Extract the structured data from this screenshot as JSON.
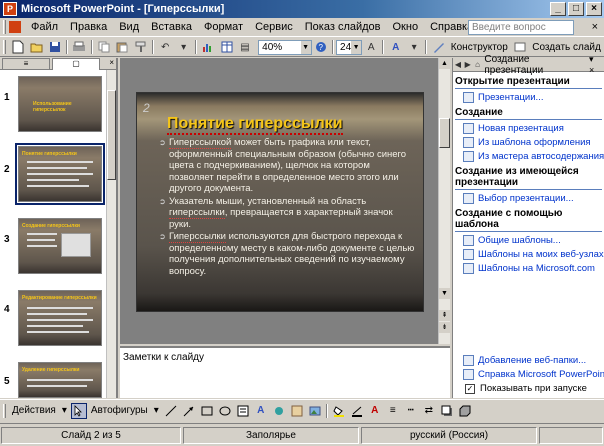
{
  "window": {
    "title": "Microsoft PowerPoint - [Гиперссылки]",
    "controls": {
      "minimize": "_",
      "maximize": "□",
      "close": "×"
    }
  },
  "menu": {
    "items": [
      "Файл",
      "Правка",
      "Вид",
      "Вставка",
      "Формат",
      "Сервис",
      "Показ слайдов",
      "Окно",
      "Справка"
    ],
    "question_placeholder": "Введите вопрос",
    "close": "×"
  },
  "toolbar": {
    "zoom": "40%",
    "font_size": "24",
    "font_color_label": "A",
    "design_label": "Конструктор",
    "new_slide_label": "Создать слайд"
  },
  "slides_pane": {
    "thumbnails": [
      {
        "number": "1",
        "title": "Использование гиперссылок"
      },
      {
        "number": "2",
        "title": "Понятие гиперссылки"
      },
      {
        "number": "3",
        "title": "Создание гиперссылки"
      },
      {
        "number": "4",
        "title": "Редактирование гиперссылки"
      },
      {
        "number": "5",
        "title": "Удаление гиперссылки"
      }
    ],
    "selected_index": 1
  },
  "slide": {
    "number": "2",
    "title": "Понятие гиперссылки",
    "bullets": [
      {
        "highlight": "Гиперссылкой",
        "text": " может быть графика или текст, оформленный специальным образом (обычно синего цвета с подчеркиванием), щелчок на котором позволяет перейти в определенное место этого или другого документа."
      },
      {
        "pre": "Указатель мыши, установленный на область ",
        "highlight": "гиперссылки",
        "post": ", превращается в характерный значок руки."
      },
      {
        "highlight": "Гиперссылки",
        "text": " используются для быстрого перехода к определенному месту в каком-либо документе с целью получения дополнительных сведений по изучаемому вопросу."
      }
    ]
  },
  "notes": {
    "placeholder": "Заметки к слайду"
  },
  "task_pane": {
    "title": "Создание презентации",
    "sections": [
      {
        "heading": "Открытие презентации",
        "links": [
          "Презентации..."
        ]
      },
      {
        "heading": "Создание",
        "links": [
          "Новая презентация",
          "Из шаблона оформления",
          "Из мастера автосодержания"
        ]
      },
      {
        "heading": "Создание из имеющейся презентации",
        "links": [
          "Выбор презентации..."
        ]
      },
      {
        "heading": "Создание с помощью шаблона",
        "links": [
          "Общие шаблоны...",
          "Шаблоны на моих веб-узлах...",
          "Шаблоны на Microsoft.com"
        ]
      }
    ],
    "bottom_links": [
      "Добавление веб-папки...",
      "Справка Microsoft PowerPoint"
    ],
    "show_at_startup_label": "Показывать при запуске",
    "show_at_startup_checked": true
  },
  "drawing_toolbar": {
    "actions_label": "Действия",
    "autoshapes_label": "Автофигуры"
  },
  "status_bar": {
    "slide_info": "Слайд 2 из 5",
    "design": "Заполярье",
    "language": "русский (Россия)"
  }
}
